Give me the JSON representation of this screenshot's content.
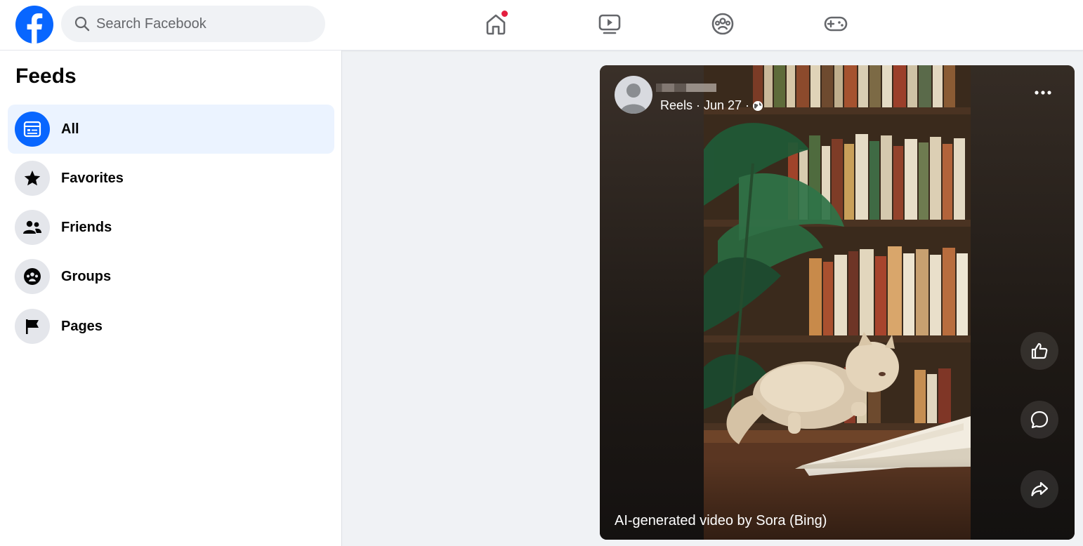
{
  "search": {
    "placeholder": "Search Facebook"
  },
  "nav": {
    "icons": [
      "home-icon",
      "video-icon",
      "groups-icon",
      "gaming-icon"
    ],
    "home_has_notification": true
  },
  "sidebar": {
    "title": "Feeds",
    "items": [
      {
        "label": "All",
        "icon": "feed-all-icon",
        "active": true
      },
      {
        "label": "Favorites",
        "icon": "star-icon",
        "active": false
      },
      {
        "label": "Friends",
        "icon": "friends-icon",
        "active": false
      },
      {
        "label": "Groups",
        "icon": "groups-icon",
        "active": false
      },
      {
        "label": "Pages",
        "icon": "flag-icon",
        "active": false
      }
    ]
  },
  "reel": {
    "meta": "Reels · Jun 27 ·",
    "caption": "AI-generated video by Sora (Bing)",
    "actions": [
      "like-icon",
      "comment-icon",
      "share-icon"
    ]
  },
  "colors": {
    "brand": "#0866ff",
    "active_item_bg": "#ebf3ff",
    "notification": "#e41e3f",
    "page_bg": "#f0f2f5"
  }
}
